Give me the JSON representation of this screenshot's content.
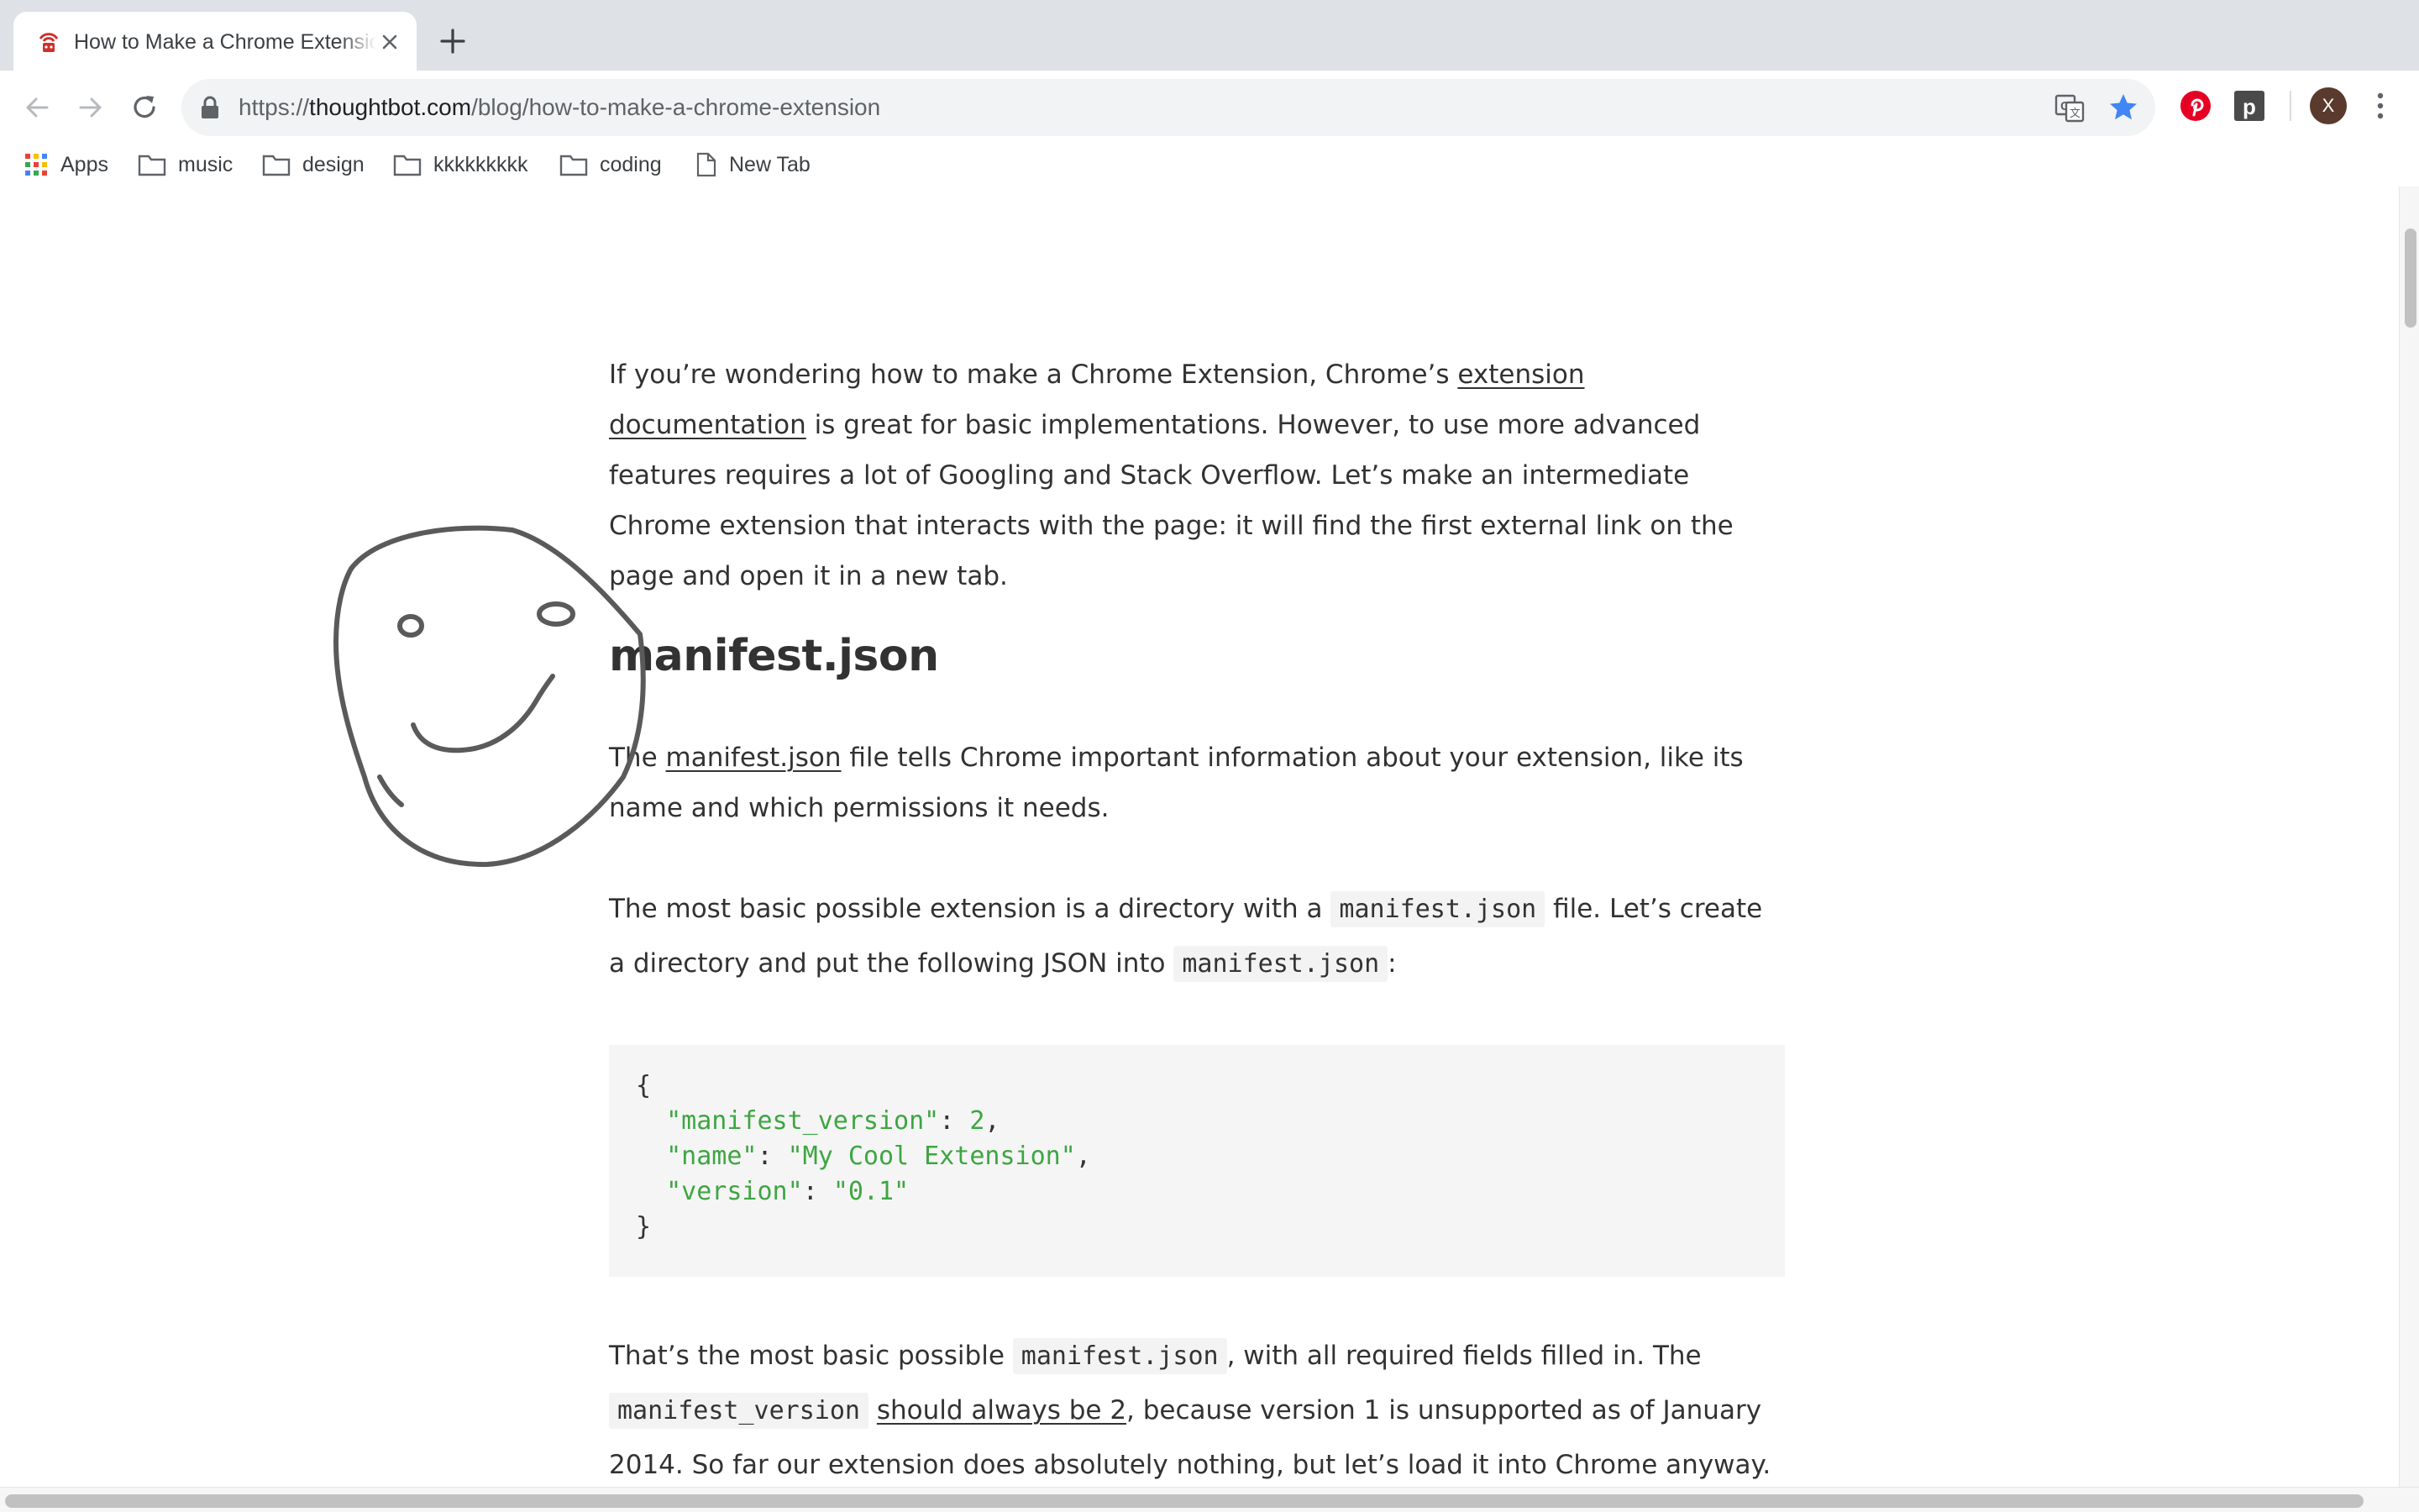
{
  "tab": {
    "title": "How to Make a Chrome Extension",
    "close_icon": "close-icon",
    "new_tab_icon": "plus-icon"
  },
  "omnibox": {
    "scheme": "https://",
    "host": "thoughtbot.com",
    "path": "/blog/how-to-make-a-chrome-extension"
  },
  "profile": {
    "initial": "X"
  },
  "bookmarks": [
    {
      "label": "Apps",
      "icon": "apps-grid-icon"
    },
    {
      "label": "music",
      "icon": "folder-icon"
    },
    {
      "label": "design",
      "icon": "folder-icon"
    },
    {
      "label": "kkkkkkkkk",
      "icon": "folder-icon"
    },
    {
      "label": "coding",
      "icon": "folder-icon"
    },
    {
      "label": "New Tab",
      "icon": "page-icon"
    }
  ],
  "article": {
    "intro": {
      "before_link": "If you’re wondering how to make a Chrome Extension, Chrome’s ",
      "link": "extension documentation",
      "after_link": " is great for basic implementations. However, to use more advanced features requires a lot of Googling and Stack Overflow. Let’s make an intermediate Chrome extension that interacts with the page: it will find the first external link on the page and open it in a new tab."
    },
    "heading": "manifest.json",
    "p2": {
      "before_link": "The ",
      "link": "manifest.json",
      "after_link": " file tells Chrome important information about your extension, like its name and which permissions it needs."
    },
    "p3": {
      "part1": "The most basic possible extension is a directory with a ",
      "code1": "manifest.json",
      "part2": " file. Let’s create a directory and put the following JSON into ",
      "code2": "manifest.json",
      "part3": ":"
    },
    "code": {
      "open": "{",
      "k1": "\"manifest_version\"",
      "v1": "2",
      "k2": "\"name\"",
      "v2": "\"My Cool Extension\"",
      "k3": "\"version\"",
      "v3": "\"0.1\"",
      "close": "}"
    },
    "p4": {
      "part1": "That’s the most basic possible ",
      "code1": "manifest.json",
      "part2": ", with all required fields filled in. The ",
      "code2": "manifest_version",
      "part3": " ",
      "link": "should always be 2",
      "part4": ", because version 1 is unsupported as of January 2014. So far our extension does absolutely nothing, but let’s load it into Chrome anyway."
    }
  },
  "colors": {
    "tabbar": "#dee1e6",
    "omnibox": "#f1f3f4",
    "star": "#4285f4",
    "pinterest": "#e60023",
    "code_green": "#3da641"
  }
}
